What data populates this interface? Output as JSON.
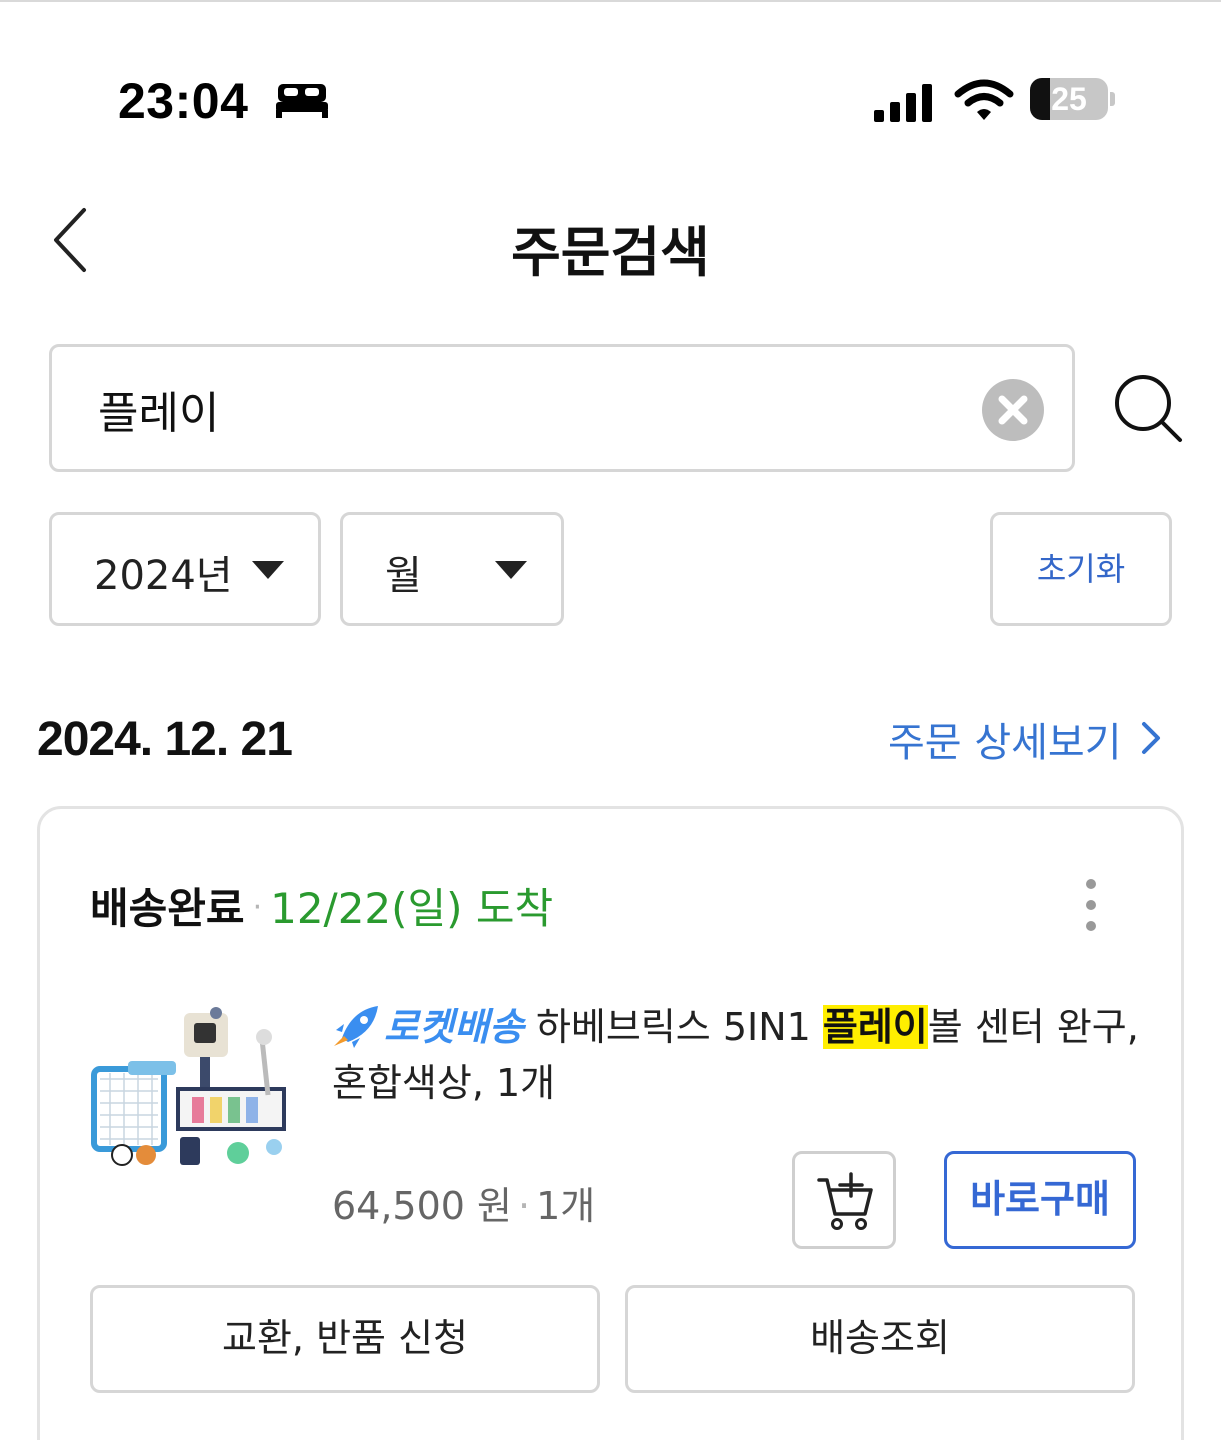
{
  "status_bar": {
    "time": "23:04",
    "battery_level": "25",
    "icons": [
      "bed-icon",
      "signal-icon",
      "wifi-icon",
      "battery-icon"
    ]
  },
  "header": {
    "title": "주문검색",
    "back_icon": "chevron-left-icon"
  },
  "search": {
    "value": "플레이",
    "clear_icon": "clear-icon",
    "search_icon": "search-icon"
  },
  "filters": {
    "year": "2024년",
    "month": "월",
    "reset_label": "초기화"
  },
  "order": {
    "date": "2024. 12. 21",
    "detail_link": "주문 상세보기",
    "card": {
      "status": "배송완료",
      "separator": "·",
      "arrival": "12/22(일) 도착",
      "product": {
        "badge": "로켓배송",
        "title_before": "하베브릭스 5IN1 ",
        "title_highlight": "플레이",
        "title_after": "볼 센터 완구,",
        "title_line2": "혼합색상, 1개",
        "price": "64,500 원",
        "quantity": "1개"
      },
      "buy_now_label": "바로구매",
      "exchange_label": "교환, 반품 신청",
      "tracking_label": "배송조회"
    }
  },
  "colors": {
    "accent_blue": "#3568d4",
    "link_blue": "#3674d1",
    "arrival_green": "#2a9a2f",
    "rocket_blue": "#3a8ef0",
    "highlight_yellow": "#ffee00"
  }
}
